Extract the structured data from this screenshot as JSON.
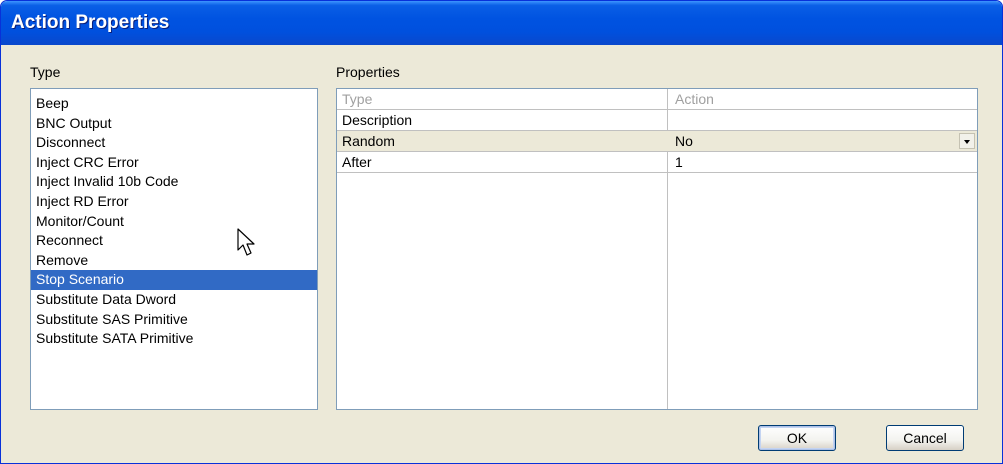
{
  "window": {
    "title": "Action Properties"
  },
  "type_panel": {
    "label": "Type",
    "items": [
      "Beep",
      "BNC Output",
      "Disconnect",
      "Inject CRC Error",
      "Inject Invalid 10b Code",
      "Inject RD Error",
      "Monitor/Count",
      "Reconnect",
      "Remove",
      "Stop Scenario",
      "Substitute Data Dword",
      "Substitute SAS Primitive",
      "Substitute SATA Primitive"
    ],
    "selected_index": 9,
    "selected_item": "Stop Scenario"
  },
  "properties_panel": {
    "label": "Properties",
    "rows": [
      {
        "name": "Type",
        "value": "Action",
        "state": "disabled"
      },
      {
        "name": "Description",
        "value": "",
        "state": "normal"
      },
      {
        "name": "Random",
        "value": "No",
        "state": "dropdown"
      },
      {
        "name": "After",
        "value": "1",
        "state": "normal"
      }
    ]
  },
  "buttons": {
    "ok": "OK",
    "cancel": "Cancel"
  },
  "icons": {
    "cursor": "arrow-cursor-icon",
    "dropdown": "chevron-down-icon"
  },
  "colors": {
    "title_bar": "#0053e1",
    "selection": "#316ac5",
    "dialog_bg": "#ece9d8",
    "border": "#7f9db9"
  }
}
